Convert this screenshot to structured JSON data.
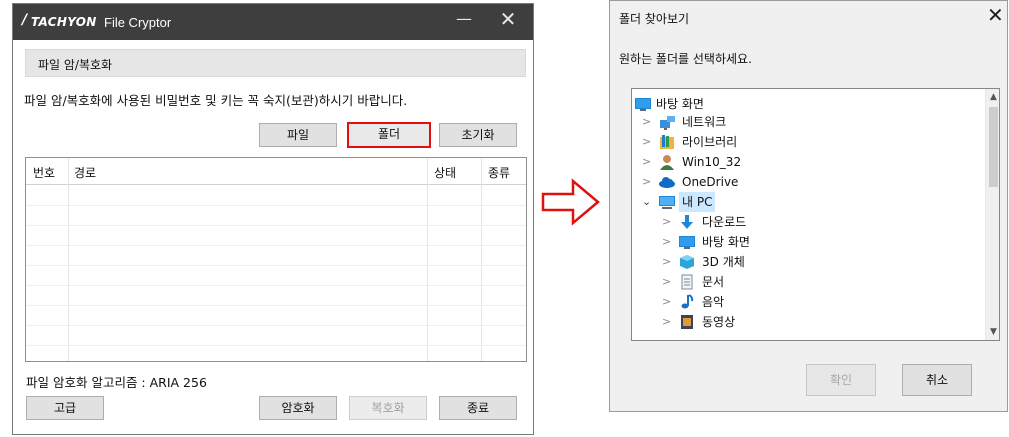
{
  "left_window": {
    "brand": "TACHYON",
    "app_name": "File Cryptor",
    "minimize_glyph": "—",
    "close_glyph": "✕",
    "section_title": "파일 암/복호화",
    "notice": "파일 암/복호화에 사용된 비밀번호 및 키는 꼭 숙지(보관)하시기 바랍니다.",
    "buttons": {
      "file": "파일",
      "folder": "폴더",
      "reset": "초기화"
    },
    "table": {
      "columns": [
        "번호",
        "경로",
        "상태",
        "종류"
      ],
      "rows": []
    },
    "algorithm_text": "파일 암호화 알고리즘 : ARIA 256",
    "bottom_buttons": {
      "advanced": "고급",
      "encrypt": "암호화",
      "decrypt": "복호화",
      "exit": "종료"
    }
  },
  "dialog": {
    "title": "폴더 찾아보기",
    "close_glyph": "✕",
    "prompt": "원하는 폴더를 선택하세요.",
    "tree": [
      {
        "label": "바탕 화면",
        "icon": "desktop-icon"
      },
      {
        "label": "네트워크",
        "icon": "network-icon"
      },
      {
        "label": "라이브러리",
        "icon": "library-icon"
      },
      {
        "label": "Win10_32",
        "icon": "user-icon"
      },
      {
        "label": "OneDrive",
        "icon": "cloud-icon"
      },
      {
        "label": "내 PC",
        "icon": "computer-icon",
        "selected": true
      },
      {
        "label": "다운로드",
        "icon": "download-icon"
      },
      {
        "label": "바탕 화면",
        "icon": "desktop-icon"
      },
      {
        "label": "3D 개체",
        "icon": "cube-icon"
      },
      {
        "label": "문서",
        "icon": "document-icon"
      },
      {
        "label": "음악",
        "icon": "music-icon"
      },
      {
        "label": "동영상",
        "icon": "video-icon"
      }
    ],
    "ok_label": "확인",
    "cancel_label": "취소"
  },
  "colors": {
    "titlebar": "#3e3e3e",
    "highlight_border": "#e01010",
    "arrow": "#e01010",
    "selection": "#cce8ff"
  }
}
